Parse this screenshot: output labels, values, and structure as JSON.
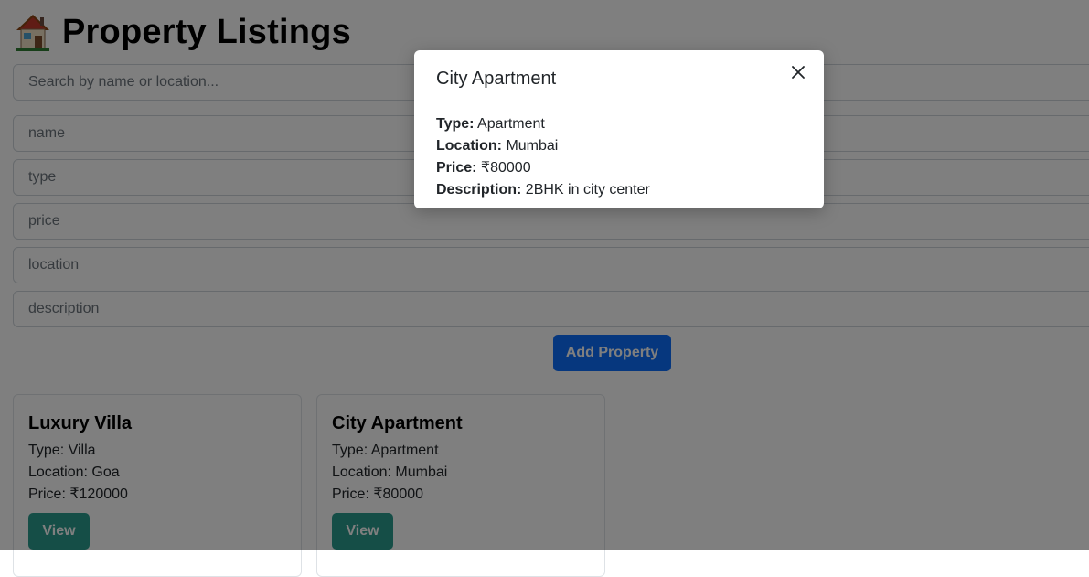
{
  "page": {
    "title": "Property Listings",
    "title_icon": "house-emoji-icon"
  },
  "search": {
    "placeholder": "Search by name or location..."
  },
  "form": {
    "name_placeholder": "name",
    "type_placeholder": "type",
    "price_placeholder": "price",
    "location_placeholder": "location",
    "description_placeholder": "description",
    "submit_label": "Add Property"
  },
  "listings": [
    {
      "title": "Luxury Villa",
      "type_line": "Type: Villa",
      "location_line": "Location: Goa",
      "price_line": "Price: ₹120000",
      "button_label": "View"
    },
    {
      "title": "City Apartment",
      "type_line": "Type: Apartment",
      "location_line": "Location: Mumbai",
      "price_line": "Price: ₹80000",
      "button_label": "View"
    }
  ],
  "modal": {
    "title": "City Apartment",
    "type_label": "Type:",
    "type_value": "Apartment",
    "location_label": "Location:",
    "location_value": "Mumbai",
    "price_label": "Price:",
    "price_value": "₹80000",
    "description_label": "Description:",
    "description_value": "2BHK in city center",
    "close_icon": "close-icon"
  },
  "colors": {
    "primary_button": "#0d6efd",
    "view_button": "#2a9d8f",
    "overlay": "rgba(0,0,0,0.5)"
  }
}
